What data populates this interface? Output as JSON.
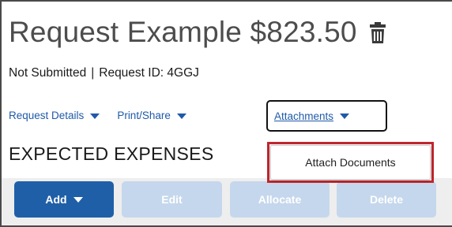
{
  "header": {
    "title": "Request Example $823.50",
    "trash_icon": "trash-icon"
  },
  "status": {
    "state": "Not Submitted",
    "separator": "|",
    "request_id_label": "Request ID: 4GGJ"
  },
  "nav": {
    "request_details": "Request Details",
    "print_share": "Print/Share",
    "attachments": "Attachments"
  },
  "section": {
    "title": "EXPECTED EXPENSES"
  },
  "attachments_menu": {
    "items": [
      "Attach Documents"
    ]
  },
  "toolbar": {
    "add": "Add",
    "edit": "Edit",
    "allocate": "Allocate",
    "delete": "Delete"
  },
  "colors": {
    "primary_button": "#1f5fa8",
    "disabled_button": "#c5d7ec",
    "link": "#1f5aa8",
    "highlight_border": "#c0272d"
  }
}
